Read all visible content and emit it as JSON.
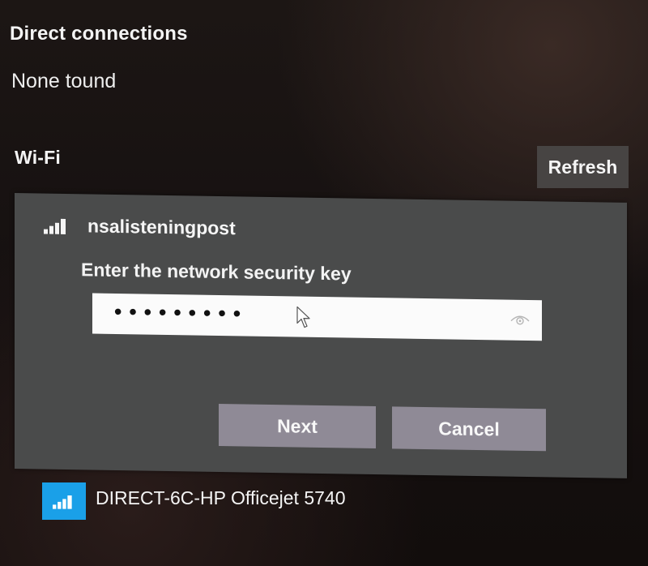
{
  "direct_connections": {
    "title": "Direct connections",
    "status": "None tound"
  },
  "wifi": {
    "title": "Wi-Fi",
    "refresh_label": "Refresh"
  },
  "network_dialog": {
    "network_name": "nsalisteningpost",
    "signal_icon": "wifi-signal-icon",
    "prompt": "Enter the network security key",
    "password_mask": "•••••••••",
    "reveal_icon": "eye-icon",
    "next_label": "Next",
    "cancel_label": "Cancel",
    "button_color": "#8f8a96",
    "panel_color": "#4a4b4b"
  },
  "devices": [
    {
      "name": "DIRECT-6C-HP Officejet 5740",
      "icon": "wifi-signal-icon",
      "icon_bg": "#1aa0e8"
    }
  ]
}
